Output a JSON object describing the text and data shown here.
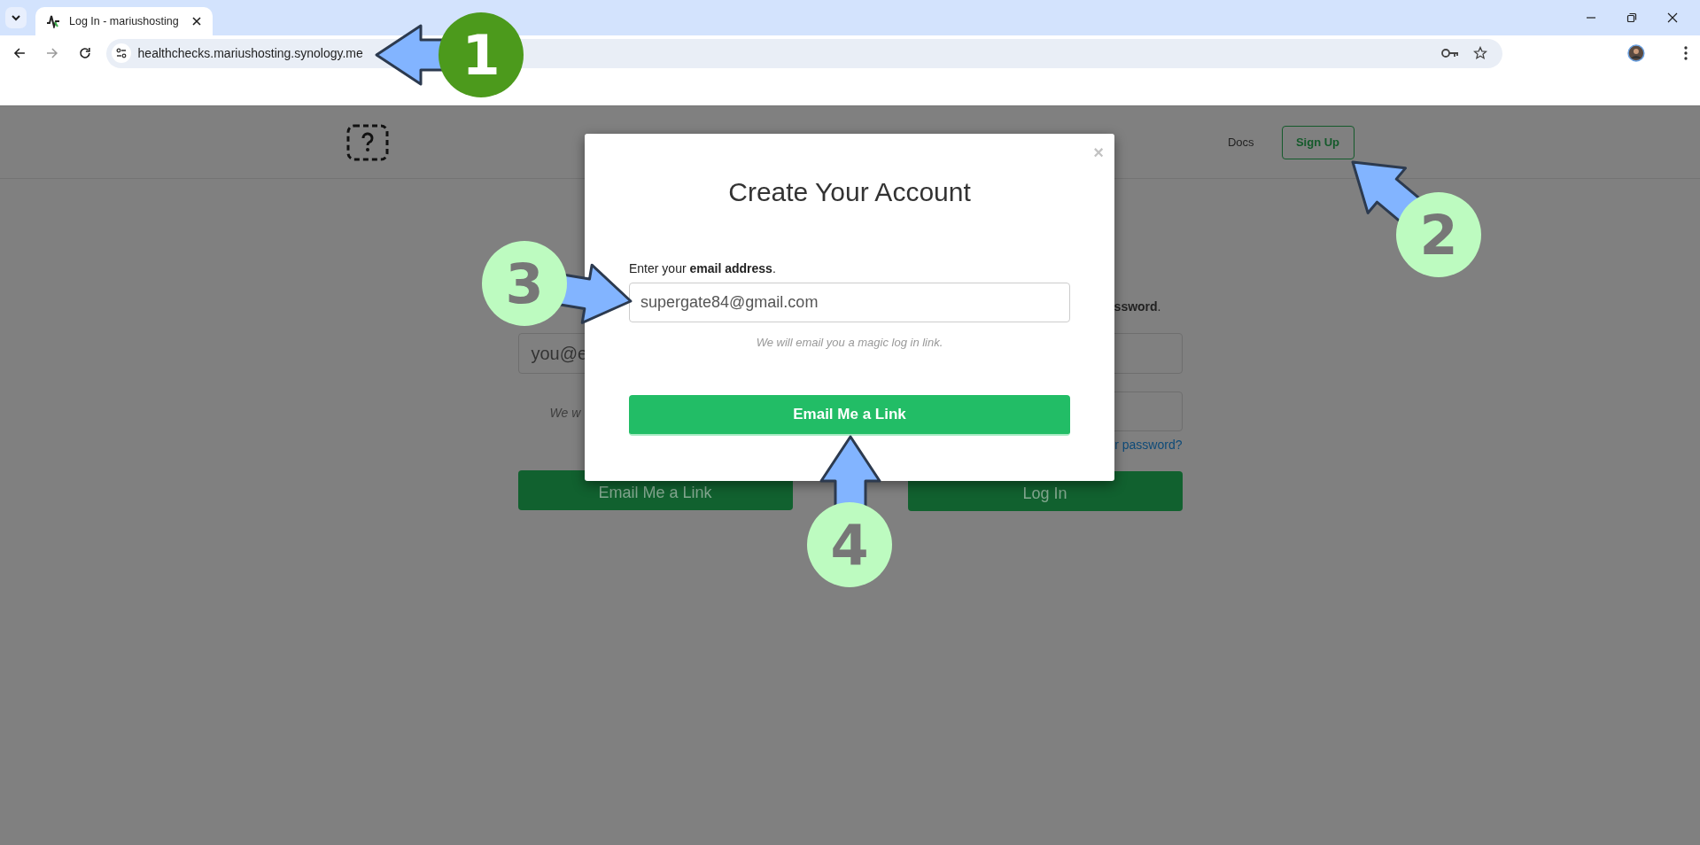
{
  "browser": {
    "tab_title": "Log In - mariushosting",
    "url": "healthchecks.mariushosting.synology.me"
  },
  "header": {
    "nav": [
      {
        "label": "Docs",
        "kind": "link"
      },
      {
        "label": "Sign Up",
        "kind": "button"
      }
    ]
  },
  "background_form": {
    "email_placeholder": "you@e",
    "note": "We w",
    "left_button": "Email Me a Link",
    "intro": "**ssword**.",
    "reset_link": "r password?",
    "right_button": "Log In"
  },
  "modal": {
    "close": "×",
    "title": "Create Your Account",
    "label": "Enter your **email address**.",
    "email_value": "supergate84@gmail.com",
    "hint": "We will email you a magic log in link.",
    "button": "Email Me a Link"
  },
  "annotations": [
    {
      "number": "1",
      "kind": "dark"
    },
    {
      "number": "2",
      "kind": "light"
    },
    {
      "number": "3",
      "kind": "light"
    },
    {
      "number": "4",
      "kind": "light"
    }
  ]
}
